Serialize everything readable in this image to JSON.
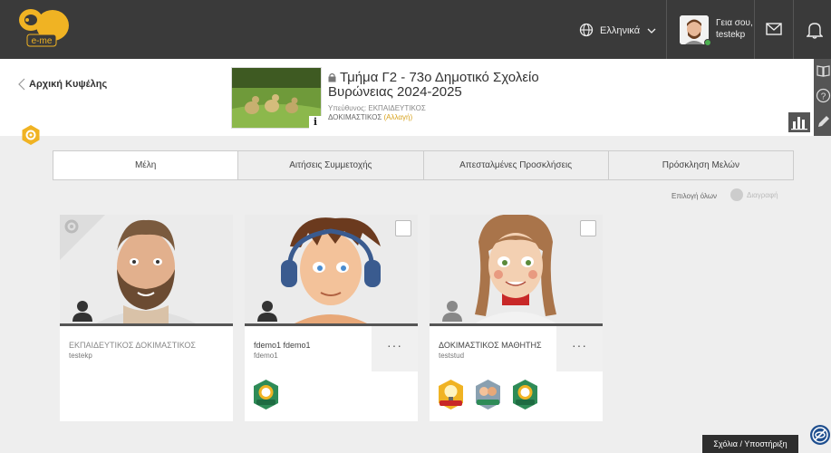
{
  "app": {
    "logo_text": "e-me"
  },
  "topbar": {
    "language": "Ελληνικά",
    "greeting": "Γεια σου,",
    "username": "testekp"
  },
  "header": {
    "back_label": "Αρχική Κυψέλης",
    "class_title": "Τμήμα Γ2 - 73ο Δημοτικό Σχολείο Βυρώνειας 2024-2025",
    "owner_label": "Υπεύθυνος: ΕΚΠΑΙΔΕΥΤΙΚΟΣ",
    "owner_name": "ΔΟΚΙΜΑΣΤΙΚΟΣ",
    "change_label": "(Αλλαγή)",
    "info_label": "i"
  },
  "tabs": [
    {
      "label": "Μέλη",
      "active": true
    },
    {
      "label": "Αιτήσεις Συμμετοχής",
      "active": false
    },
    {
      "label": "Απεσταλμένες Προσκλήσεις",
      "active": false
    },
    {
      "label": "Πρόσκληση Μελών",
      "active": false
    }
  ],
  "actions": {
    "select_all": "Επιλογή όλων",
    "delete": "Διαγραφή"
  },
  "members": [
    {
      "full_name": "ΕΚΠΑΙΔΕΥΤΙΚΟΣ ΔΟΚΙΜΑΣΤΙΚΟΣ",
      "username": "testekp",
      "role": "owner"
    },
    {
      "full_name": "fdemo1 fdemo1",
      "username": "fdemo1",
      "more": "···",
      "badges": [
        "achievement-badge"
      ]
    },
    {
      "full_name": "ΔΟΚΙΜΑΣΤΙΚΟΣ ΜΑΘΗΤΗΣ",
      "username": "teststud",
      "more": "···",
      "badges": [
        "creativity-badge",
        "kindness-badge",
        "achievement-badge"
      ]
    }
  ],
  "footer": {
    "support_label": "Σχόλια / Υποστήριξη"
  },
  "colors": {
    "topbar": "#3a3a3a",
    "accent": "#f0b323",
    "link": "#d7a21d",
    "badge_green": "#2e8b57"
  }
}
